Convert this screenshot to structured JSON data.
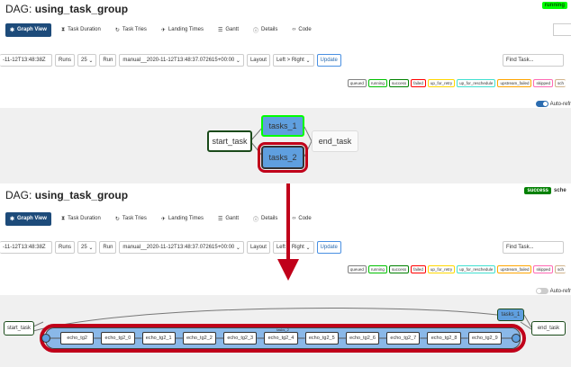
{
  "colors": {
    "navy": "#1d4b7a",
    "running": "#00ff00",
    "success": "#008000",
    "highlight": "#c0001a",
    "task_blue": "#5f9fdf",
    "edge": "#777777"
  },
  "panels": [
    {
      "dag_title_prefix": "DAG:",
      "dag_name": "using_task_group",
      "state_badge": "running",
      "nav": [
        {
          "label": "Graph View",
          "icon": "graph-icon"
        },
        {
          "label": "Task Duration",
          "icon": "duration-icon"
        },
        {
          "label": "Task Tries",
          "icon": "tries-icon"
        },
        {
          "label": "Landing Times",
          "icon": "landing-icon"
        },
        {
          "label": "Gantt",
          "icon": "gantt-icon"
        },
        {
          "label": "Details",
          "icon": "details-icon"
        },
        {
          "label": "Code",
          "icon": "code-icon"
        }
      ],
      "base_date": "-11-12T13:48:38Z",
      "runs_label": "Runs",
      "runs_value": "25",
      "run_label": "Run",
      "run_value": "manual__2020-11-12T13:48:37.072615+00:00",
      "layout_label": "Layout",
      "layout_value": "Left > Right",
      "update_label": "Update",
      "find_placeholder": "Find Task...",
      "legend": [
        "queued",
        "running",
        "success",
        "failed",
        "up_for_retry",
        "up_for_reschedule",
        "upstream_failed",
        "skipped",
        "sch"
      ],
      "auto_refresh": "Auto-refr",
      "nodes": {
        "start": "start_task",
        "t1": "tasks_1",
        "t2": "tasks_2",
        "end": "end_task"
      }
    },
    {
      "dag_title_prefix": "DAG:",
      "dag_name": "using_task_group",
      "state_badge": "success",
      "sched_label": "sche",
      "nav": [
        {
          "label": "Graph View",
          "icon": "graph-icon"
        },
        {
          "label": "Task Duration",
          "icon": "duration-icon"
        },
        {
          "label": "Task Tries",
          "icon": "tries-icon"
        },
        {
          "label": "Landing Times",
          "icon": "landing-icon"
        },
        {
          "label": "Gantt",
          "icon": "gantt-icon"
        },
        {
          "label": "Details",
          "icon": "details-icon"
        },
        {
          "label": "Code",
          "icon": "code-icon"
        }
      ],
      "base_date": "-11-12T13:48:38Z",
      "runs_label": "Runs",
      "runs_value": "25",
      "run_label": "Run",
      "run_value": "manual__2020-11-12T13:48:37.072615+00:00",
      "layout_label": "Layout",
      "layout_value": "Left > Right",
      "update_label": "Update",
      "find_placeholder": "Find Task...",
      "legend": [
        "queued",
        "running",
        "success",
        "failed",
        "up_for_retry",
        "up_for_reschedule",
        "upstream_failed",
        "skipped",
        "sch"
      ],
      "auto_refresh": "Auto-refr",
      "group_label": "tasks_2",
      "nodes": {
        "start": "start_task",
        "t1": "tasks_1",
        "end": "end_task"
      },
      "chain": [
        "echo_tg2",
        "echo_tg2_0",
        "echo_tg2_1",
        "echo_tg2_2",
        "echo_tg2_3",
        "echo_tg2_4",
        "echo_tg2_5",
        "echo_tg2_6",
        "echo_tg2_7",
        "echo_tg2_8",
        "echo_tg2_9"
      ]
    }
  ]
}
